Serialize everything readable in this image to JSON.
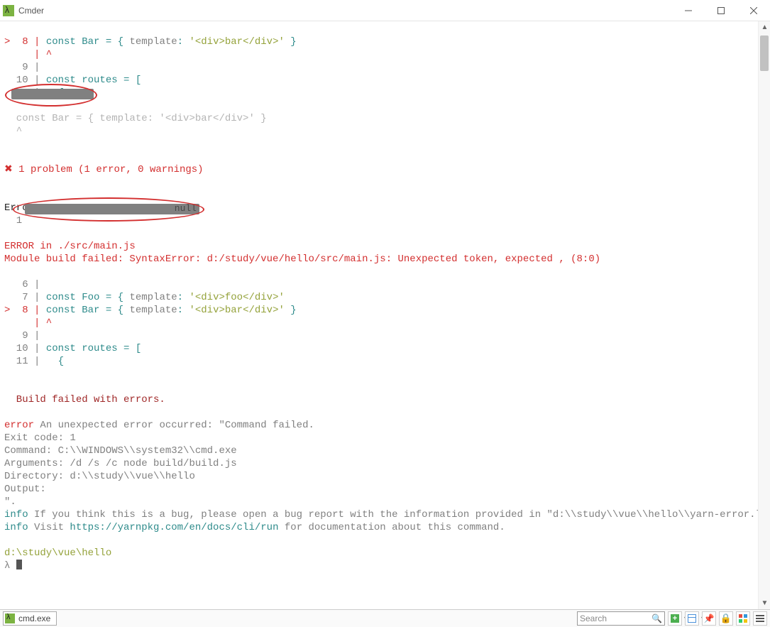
{
  "window": {
    "title": "Cmder"
  },
  "lines": {
    "l1a": ">  8 | ",
    "l1b": "const Bar = { ",
    "l1c": "template",
    "l1d": ": ",
    "l1e": "'<div>bar</div>'",
    "l1f": " }",
    "l2": "     | ^",
    "l3": "   9 | ",
    "l4a": "  10 | ",
    "l4b": "const routes = [",
    "l5a": "  11 |   ",
    "l5b": "{",
    "gline1": "  const Bar = { template: '<div>bar</div>' }",
    "gline2": "  ^",
    "problem_x": "✖",
    "problem": " 1 problem (1 error, 0 warnings)",
    "errors": "Errors:",
    "err1_num": "  1  ",
    "redact2_text": "null",
    "errin": "ERROR in ./src/main.js",
    "modfail": "Module build failed: SyntaxError: d:/study/vue/hello/src/main.js: Unexpected token, expected , (8:0)",
    "b6": "   6 | ",
    "b7a": "   7 | ",
    "b7b": "const Foo = { ",
    "b7c": "template",
    "b7d": ": ",
    "b7e": "'<div>foo</div>'",
    "b8a": ">  8 | ",
    "b8b": "const Bar = { ",
    "b8c1": "template",
    "b8d": ": ",
    "b8e": "'<div>bar</div>'",
    "b8f": " }",
    "b8caret": "     | ^",
    "b9": "   9 | ",
    "b10a": "  10 | ",
    "b10b": "const routes = [",
    "b11a": "  11 |   ",
    "b11b": "{",
    "buildfail": "  Build failed with errors.",
    "er_label": "error",
    "er_text": " An unexpected error occurred: \"Command failed.",
    "exitcode": "Exit code: 1",
    "command": "Command: C:\\\\WINDOWS\\\\system32\\\\cmd.exe",
    "arguments": "Arguments: /d /s /c node build/build.js",
    "directory": "Directory: d:\\\\study\\\\vue\\\\hello",
    "output": "Output:",
    "quote": "\".",
    "info1a": "info",
    "info1b": " If you think this is a bug, please open a bug report with the information provided in \"d:\\\\study\\\\vue\\\\hello\\\\yarn-error.log\".",
    "info2a": "info",
    "info2b": " Visit ",
    "info2c": "https://yarnpkg.com/en/docs/cli/run",
    "info2d": " for documentation about this command.",
    "cwd": "d:\\study\\vue\\hello",
    "prompt": "λ "
  },
  "statusbar": {
    "tab_label": "cmd.exe",
    "search_placeholder": "Search"
  },
  "colors": {
    "red": "#d32f2f",
    "darkred": "#a02828",
    "grey": "#808080",
    "faded": "#b4b4b4",
    "green": "#94a23a",
    "teal": "#2e8b8b"
  }
}
